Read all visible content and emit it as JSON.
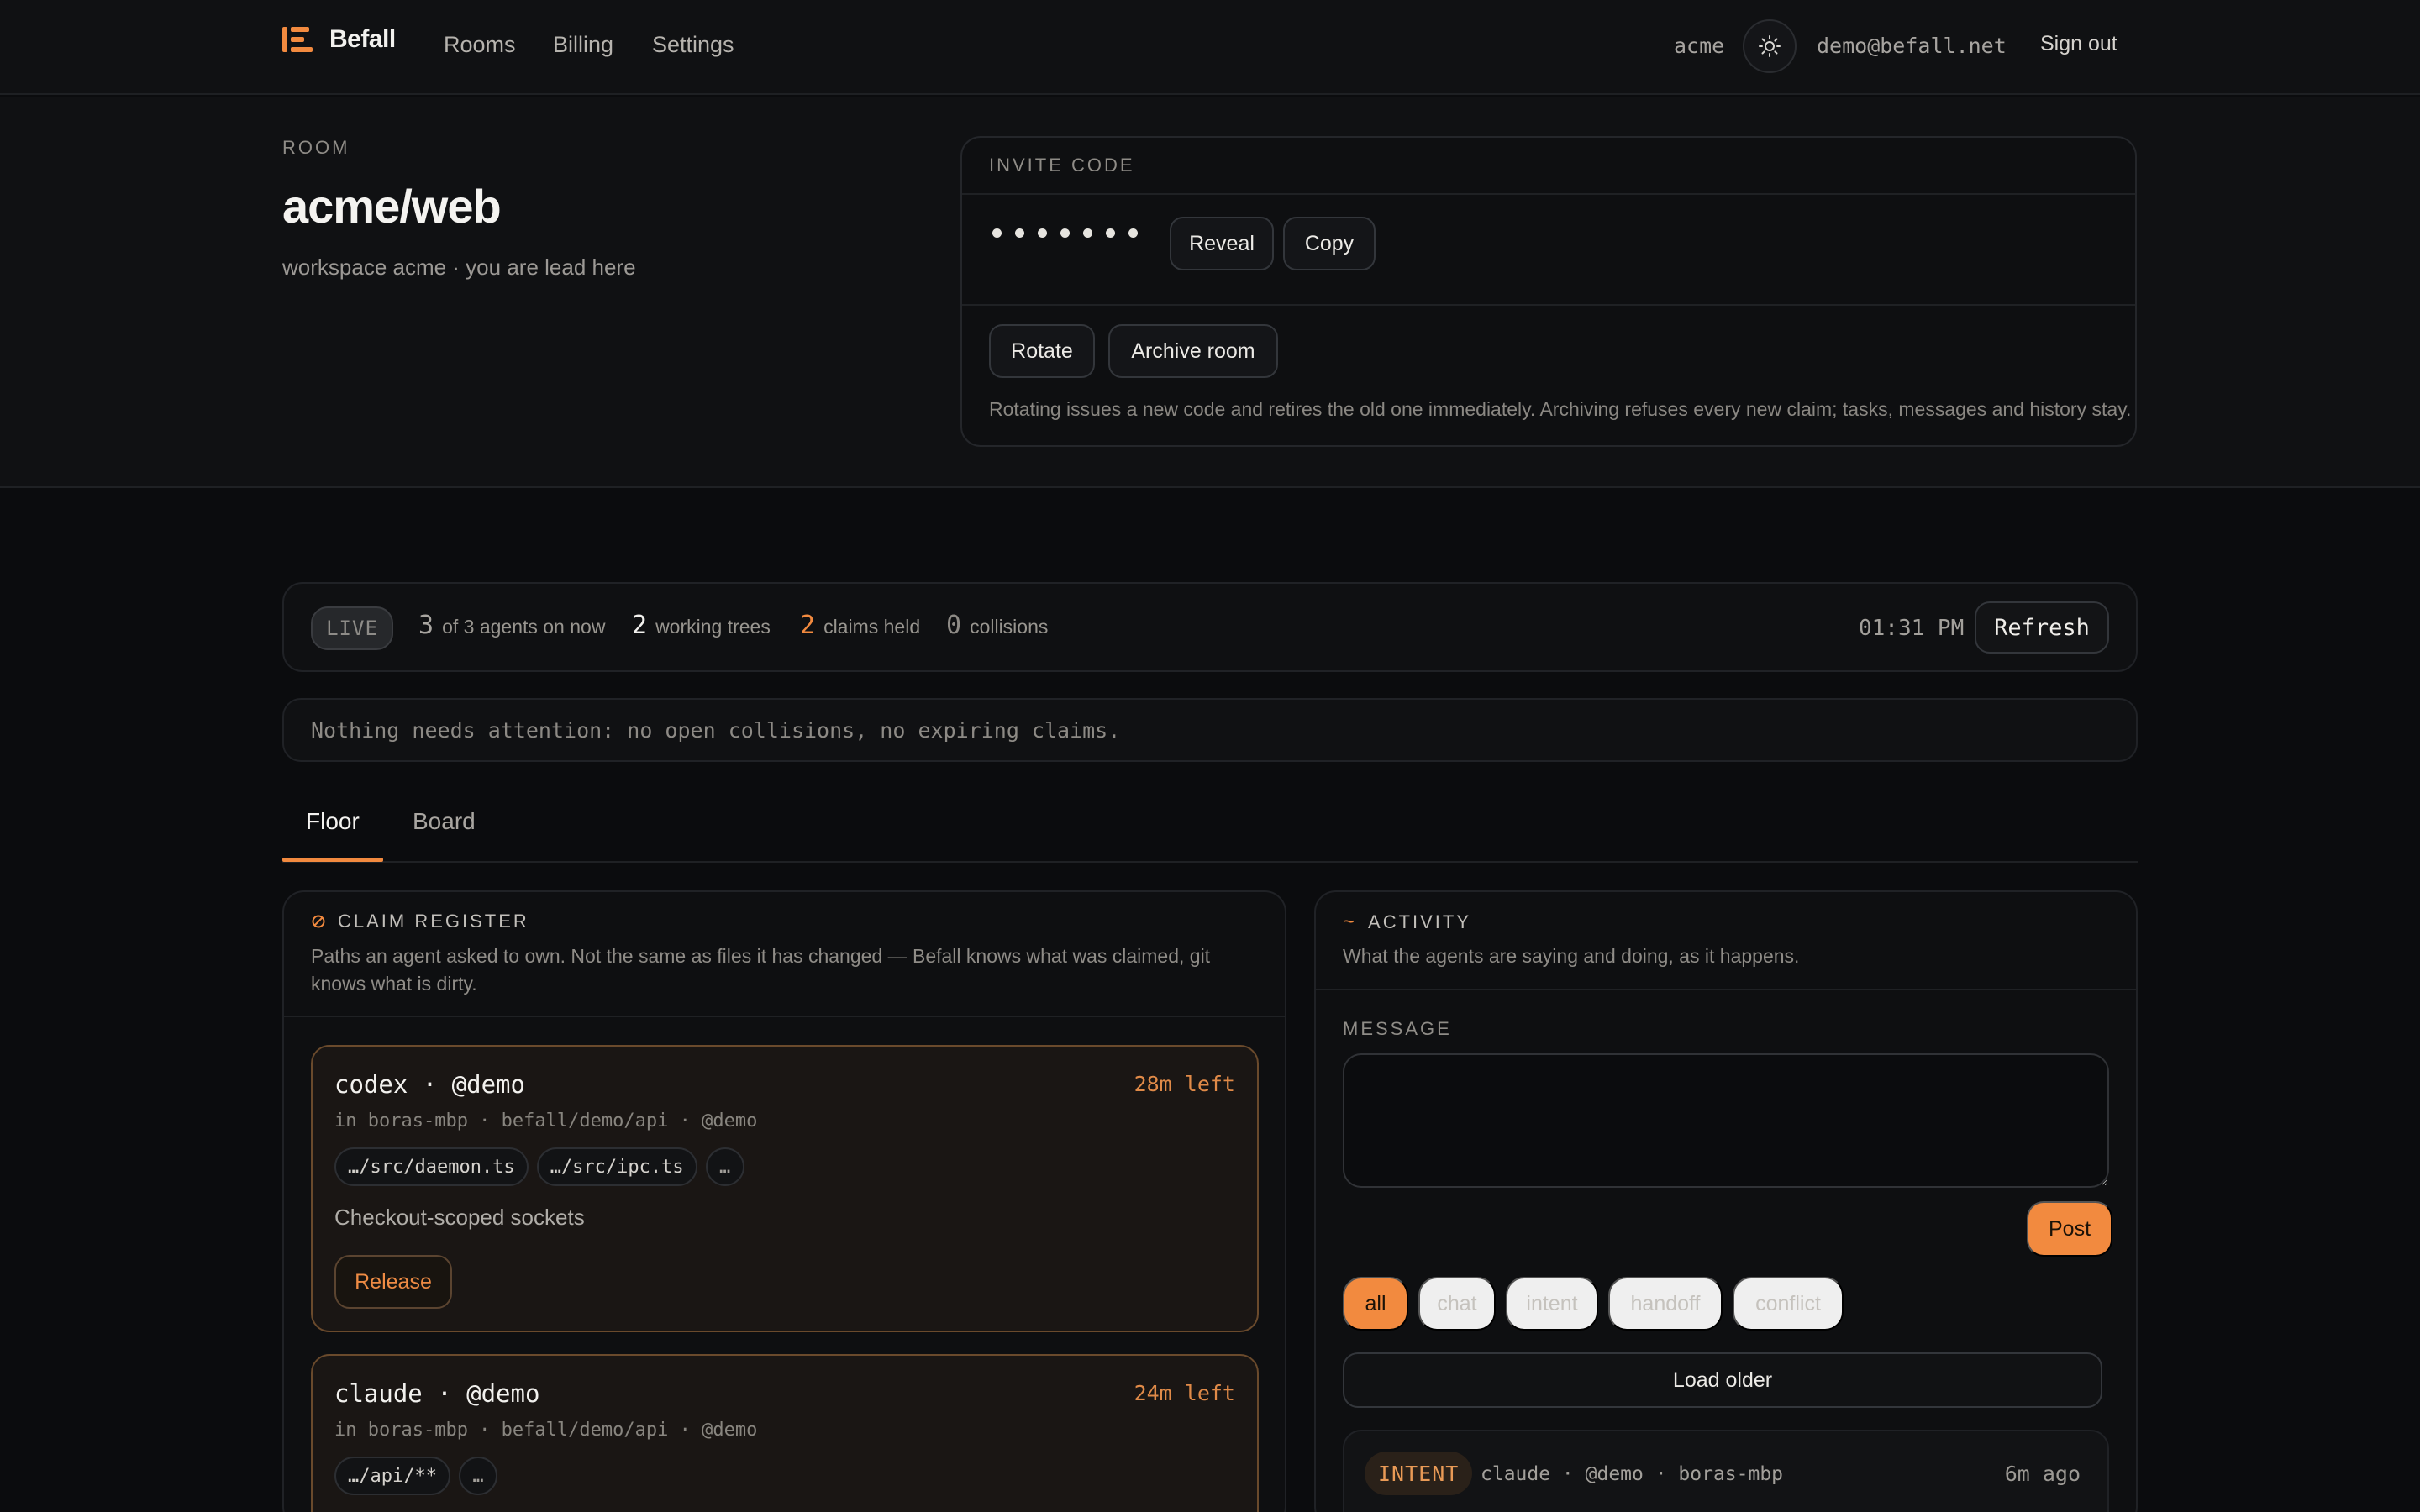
{
  "nav": {
    "brand": "Befall",
    "links": [
      "Rooms",
      "Billing",
      "Settings"
    ],
    "workspace": "acme",
    "theme_icon": "sun-icon",
    "email": "demo@befall.net",
    "sign_out": "Sign out"
  },
  "room": {
    "eyebrow": "ROOM",
    "title": "acme/web",
    "subtitle": "workspace acme · you are lead here"
  },
  "invite": {
    "eyebrow": "INVITE CODE",
    "masked": "•••••••",
    "reveal": "Reveal",
    "copy": "Copy",
    "rotate": "Rotate",
    "archive": "Archive room",
    "note": "Rotating issues a new code and retires the old one immediately. Archiving refuses every new claim; tasks, messages and history stay."
  },
  "status": {
    "live": "LIVE",
    "agents_num": "3",
    "agents_label": "of 3 agents on now",
    "trees_num": "2",
    "trees_label": "working trees",
    "claims_num": "2",
    "claims_label": "claims held",
    "collisions_num": "0",
    "collisions_label": "collisions",
    "time": "01:31 PM",
    "refresh": "Refresh"
  },
  "attention": "Nothing needs attention: no open collisions, no expiring claims.",
  "tabs": [
    "Floor",
    "Board"
  ],
  "claims_panel": {
    "title": "CLAIM REGISTER",
    "desc": "Paths an agent asked to own. Not the same as files it has changed — Befall knows what was claimed, git knows what is dirty.",
    "claims": [
      {
        "title": "codex · @demo",
        "left": "28m left",
        "meta": "in boras-mbp · befall/demo/api · @demo",
        "paths": [
          "…/src/daemon.ts",
          "…/src/ipc.ts"
        ],
        "more": "…",
        "note": "Checkout-scoped sockets",
        "release": "Release"
      },
      {
        "title": "claude · @demo",
        "left": "24m left",
        "meta": "in boras-mbp · befall/demo/api · @demo",
        "paths": [
          "…/api/**"
        ],
        "more": "…"
      }
    ]
  },
  "activity": {
    "title": "ACTIVITY",
    "desc": "What the agents are saying and doing, as it happens.",
    "message_label": "MESSAGE",
    "post": "Post",
    "filters": [
      "all",
      "chat",
      "intent",
      "handoff",
      "conflict"
    ],
    "load_older": "Load older",
    "event": {
      "tag": "INTENT",
      "who": "claude · @demo · boras-mbp",
      "time": "6m ago"
    }
  },
  "colors": {
    "accent": "#f28a3f",
    "background": "#0b0c0e",
    "surface": "#101113"
  }
}
